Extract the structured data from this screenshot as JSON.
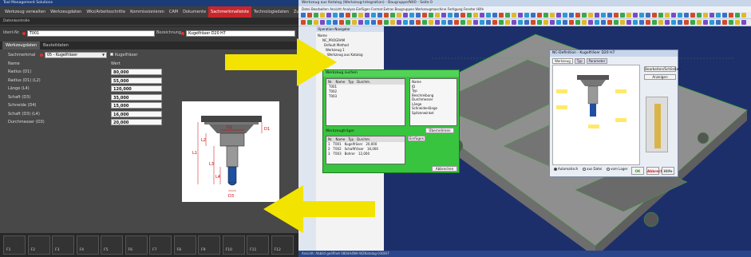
{
  "left_app": {
    "title": "Tool Management Solutions",
    "menu": [
      "Werkzeug verwalten",
      "Werkzeugdaten",
      "Wkz/Arbeitsschritte",
      "Kommissionieren",
      "CAM",
      "Dokumente",
      "Sachmerkmalleiste",
      "Technologiedaten",
      "Zuordnen",
      "Lager"
    ],
    "active_menu": "Sachmerkmalleiste",
    "subheader": "Datenkontrolle",
    "ident_label": "Ident-Nr.",
    "ident_value": "T001",
    "description_label": "Bezeichnung",
    "description_value": "Kugelfräser D20 H7",
    "tabs": [
      "Werkzeugdaten",
      "Bauteildaten"
    ],
    "active_tab": "Werkzeugdaten",
    "class_label": "Sachmerkmal",
    "class_value": "05 - Kugelfräser",
    "class_check_label": "Kugelfräser",
    "col_name": "Name",
    "col_value": "Wert",
    "params": [
      {
        "name": "Radius (D1)",
        "value": "80,000"
      },
      {
        "name": "Radius (D1) (L2)",
        "value": "55,000"
      },
      {
        "name": "Länge (L4)",
        "value": "120,000"
      },
      {
        "name": "Schaft (D3)",
        "value": "35,000"
      },
      {
        "name": "Schneide (D4)",
        "value": "15,000"
      },
      {
        "name": "Schaft (D3) (L4)",
        "value": "16,000"
      },
      {
        "name": "Durchmesser (D3)",
        "value": "20,000"
      }
    ],
    "drawing_labels": [
      "L1",
      "L2",
      "L3",
      "L4",
      "D1",
      "D2",
      "D3"
    ],
    "fkeys": [
      "F1",
      "F2",
      "F3",
      "F4",
      "F5",
      "F6",
      "F7",
      "F8",
      "F9",
      "F10",
      "F11",
      "F12"
    ]
  },
  "right_app": {
    "title": "Werkzeug aus Katalog (Werkzeug-Integration) - Baugruppe/NX0 - Seite 0",
    "menu": "Datei   Bearbeiten   Ansicht   Analyse   Einfügen   Format   Extras   Baugruppen   Werkzeugmaschine   Fertigung   Fenster   Hilfe",
    "navigator_title": "Operation-Navigator",
    "navigator_items": [
      "Name",
      "NC_PROGRAM",
      "Default Method",
      "Werkzeug 1",
      "Werkzeug aus Katalog"
    ],
    "tool_dialog_title": "Werkzeug suchen",
    "tool_dialog_rows": [
      "T001",
      "T002",
      "T003"
    ],
    "tool_dialog_headers": [
      "Nr.",
      "Name",
      "Typ",
      "Durchm."
    ],
    "tool_dialog_right": [
      "Name",
      "ID",
      "Typ",
      "Beschreibung",
      "Durchmesser",
      "Länge",
      "Schneidenlänge",
      "Spitzenwinkel"
    ],
    "tool_dialog_button": "Übernehmen",
    "holder_section": "Werkzeugträger",
    "holder_button": "Einfügen",
    "holder_headers": [
      "Nr.",
      "Name",
      "Typ",
      "Durchm."
    ],
    "holder_rows": [
      [
        "1",
        "T001",
        "Kugelfräser",
        "20,000"
      ],
      [
        "2",
        "T002",
        "Schaftfräser",
        "16,000"
      ],
      [
        "3",
        "T003",
        "Bohrer",
        "12,000"
      ]
    ],
    "holder_ok_button": "Abbrechen",
    "props_dialog_title": "NC-Definition - Kugelfräser D20 H7",
    "props_tabs": [
      "Werkzeug",
      "Typ",
      "Parameter"
    ],
    "props_side_buttons": [
      "Bearbeiten/Schließen",
      "Anzeigen"
    ],
    "props_bottom_buttons": [
      "OK",
      "Abbrechen",
      "Hilfe"
    ],
    "props_radio": [
      "Automatisch",
      "aus Datei",
      "vom Lager"
    ],
    "status": "Ansicht: Abbild geöffnet   0804A4NH   WZKatalog-030/H7"
  },
  "colors": {
    "accent_red": "#c9262b",
    "arrow_yellow": "#f2e400",
    "dialog_green": "#2fc03a",
    "viewport_blue": "#1d2f6b",
    "part_gray": "#8f8f8f"
  }
}
